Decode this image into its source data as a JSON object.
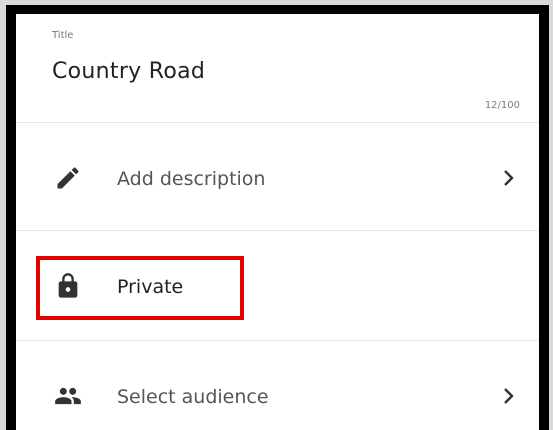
{
  "title_field": {
    "label": "Title",
    "value": "Country Road",
    "char_count": "12/100"
  },
  "rows": [
    {
      "label": "Add description",
      "icon": "pencil-icon",
      "has_chevron": true
    },
    {
      "label": "Private",
      "icon": "lock-icon",
      "has_chevron": false,
      "highlighted": true
    },
    {
      "label": "Select audience",
      "icon": "people-icon",
      "has_chevron": true
    }
  ],
  "colors": {
    "highlight": "#e50000",
    "icon": "#333333"
  }
}
